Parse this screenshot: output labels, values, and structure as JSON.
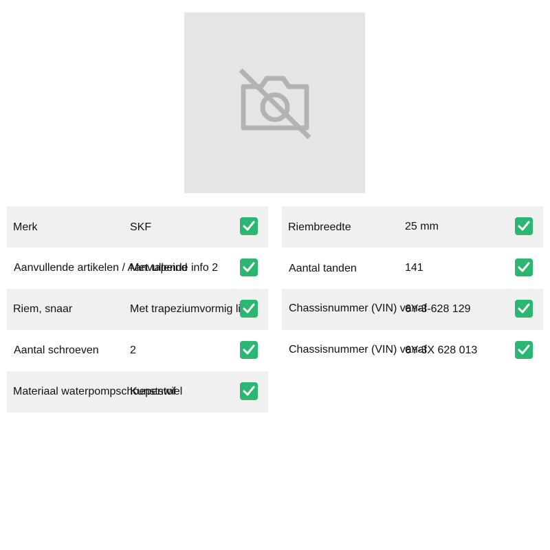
{
  "product_image": {
    "icon": "camera-off-icon",
    "placeholder_color": "#e5e5e5",
    "icon_color": "#b3b3b3"
  },
  "specs_left": [
    {
      "label": "Merk",
      "value": "SKF"
    },
    {
      "label": "Aanvullende artikelen / Aanvullende info 2",
      "value": "Met tapeind"
    },
    {
      "label": "Riem, snaar",
      "value": "Met trapeziumvormig lind"
    },
    {
      "label": "Aantal schroeven",
      "value": "2"
    },
    {
      "label": "Materiaal waterpompschoepenwiel",
      "value": "Kunststof"
    }
  ],
  "specs_right": [
    {
      "label": "Riembreedte",
      "value": "25 mm"
    },
    {
      "label": "Aantal tanden",
      "value": "141"
    },
    {
      "label": "Chassisnummer (VIN) vanaf",
      "value": "6Y-3-628 129"
    },
    {
      "label": "Chassisnummer (VIN) vanaf",
      "value": "6Y-3X 628 013"
    }
  ],
  "check_icon": "check-mark-icon",
  "colors": {
    "row_alt": "#f0f0f0",
    "check_bg": "#2bb673"
  }
}
